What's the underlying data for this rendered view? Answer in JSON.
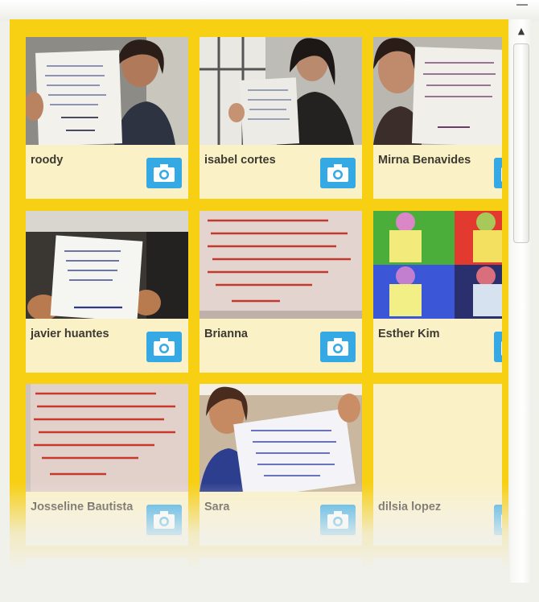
{
  "scrollbar": {
    "up_arrow_glyph": "▲"
  },
  "profiles": [
    {
      "name": "roody",
      "camera_icon": "camera-icon"
    },
    {
      "name": "isabel cortes",
      "camera_icon": "camera-icon"
    },
    {
      "name": "Mirna Benavides",
      "camera_icon": "camera-icon"
    },
    {
      "name": "javier huantes",
      "camera_icon": "camera-icon"
    },
    {
      "name": "Brianna",
      "camera_icon": "camera-icon"
    },
    {
      "name": "Esther Kim",
      "camera_icon": "camera-icon"
    },
    {
      "name": "Josseline Bautista",
      "camera_icon": "camera-icon"
    },
    {
      "name": "Sara",
      "camera_icon": "camera-icon"
    },
    {
      "name": "dilsia lopez",
      "camera_icon": "camera-icon"
    }
  ],
  "colors": {
    "board": "#f7cf13",
    "card": "#fbf1c7",
    "camera_button": "#34a9e3"
  }
}
